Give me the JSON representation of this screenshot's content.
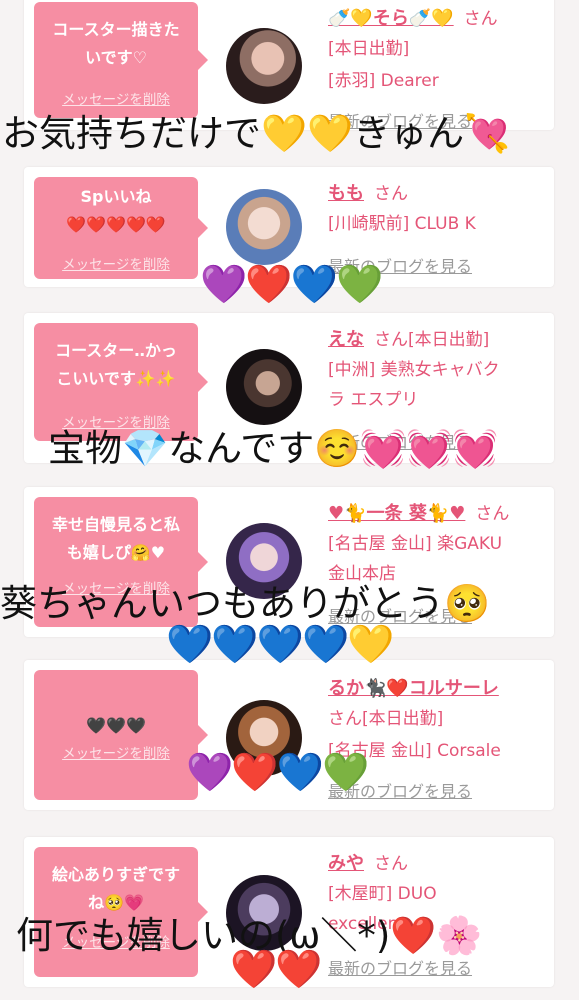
{
  "cards": [
    {
      "message": "コースター描きた\nいです♡",
      "delete_label": "メッセージを削除",
      "name": "🍼💛そら🍼💛",
      "san": "さん",
      "lines": [
        "[本日出勤]",
        "[赤羽] Dearer"
      ],
      "blog": "最新のブログを見る"
    },
    {
      "message": "Spいいね\n❤️❤️❤️❤️❤️",
      "delete_label": "メッセージを削除",
      "name": "もも",
      "san": "さん",
      "lines": [
        "[川崎駅前] CLUB K"
      ],
      "blog": "最新のブログを見る"
    },
    {
      "message": "コースター‥かっ\nこいいです✨✨",
      "delete_label": "メッセージを削除",
      "name": "えな",
      "san": "さん[本日出勤]",
      "lines": [
        "[中洲] 美熟女キャバク",
        "ラ エスプリ"
      ],
      "blog": "最新のブログを見る"
    },
    {
      "message": "幸せ自慢見ると私\nも嬉しぴ🤗♥",
      "delete_label": "メッセージを削除",
      "name": "♥🐈一条 葵🐈♥",
      "san": "さん",
      "lines": [
        "[名古屋 金山] 楽GAKU",
        "金山本店"
      ],
      "blog": "最新のブログを見る"
    },
    {
      "message": "🖤🖤🖤",
      "delete_label": "メッセージを削除",
      "name": "るか🐈‍⬛❤️コルサーレ",
      "san": "",
      "lines": [
        "さん[本日出勤]",
        "[名古屋 金山] Corsale"
      ],
      "blog": "最新のブログを見る"
    },
    {
      "message": "絵心ありすぎです\nね🥺💗",
      "delete_label": "メッセージを削除",
      "name": "みや",
      "san": "さん",
      "lines": [
        "[木屋町] DUO",
        "excellent"
      ],
      "blog": "最新のブログを見る"
    }
  ],
  "overlays": {
    "text1": "お気持ちだけで💛💛きゅん💘",
    "hearts1": "💜❤️💙💚",
    "text2": "宝物💎なんです☺️💓💓💓",
    "text3": "葵ちゃんいつもありがとう🥺",
    "hearts3": "💙💙💙💙💛",
    "hearts4": "💜❤️💙💚",
    "text5": "何でも嬉しいの(ω＼*)❤️🌸",
    "hearts5": "❤️❤️"
  },
  "colors": {
    "bubble": "#f68ea3",
    "accent": "#e45577",
    "background": "#f6f3f3"
  }
}
